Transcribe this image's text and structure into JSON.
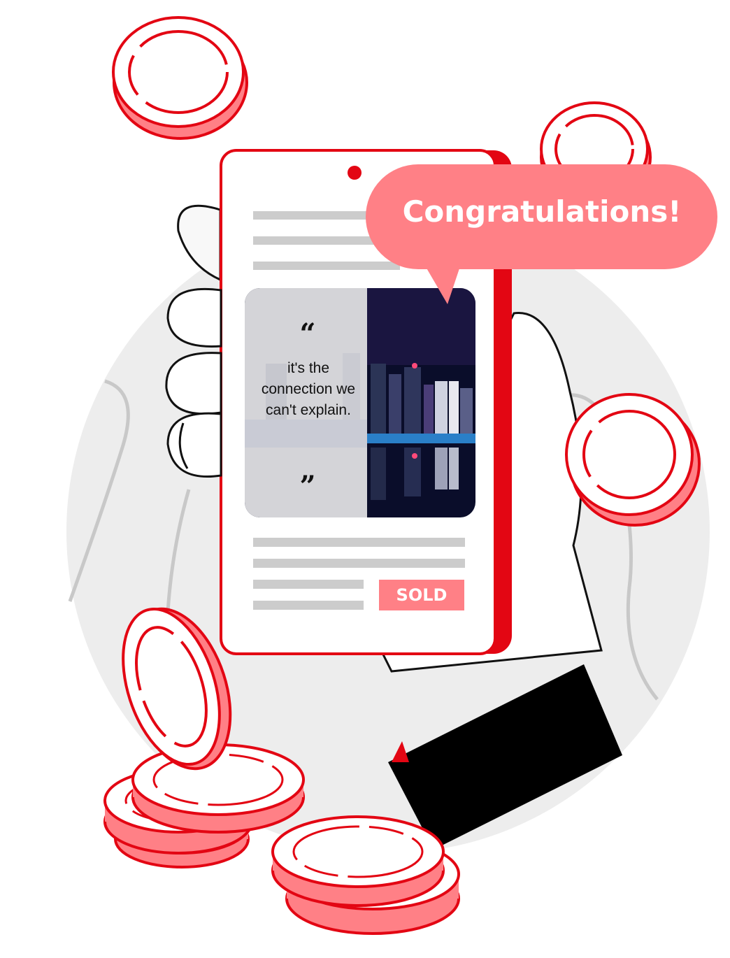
{
  "bubble": {
    "text": "Congratulations!"
  },
  "card": {
    "quote_open": "“",
    "quote": "it's the connection we can't explain.",
    "quote_close": "”"
  },
  "badge": {
    "label": "SOLD"
  },
  "colors": {
    "accent_red": "#e30613",
    "coin_fill": "#ff8086",
    "bubble_fill": "#ff8086",
    "background_circle": "#ededed",
    "sleeve": "#000000"
  }
}
